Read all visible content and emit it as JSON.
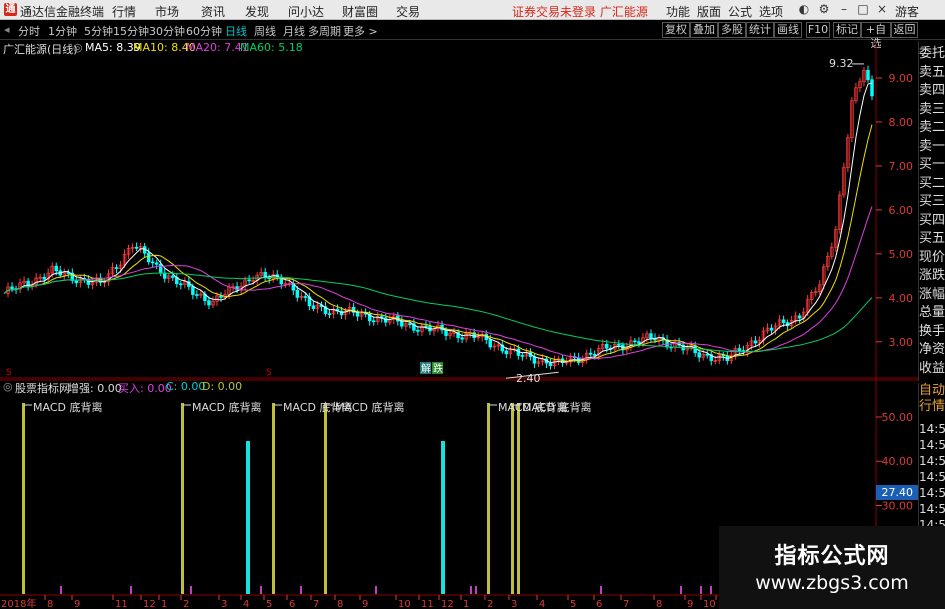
{
  "app": {
    "logo_text": "通",
    "name": "通达信金融终端",
    "warning": "证券交易未登录",
    "stock_name": "广汇能源",
    "guest": "游客"
  },
  "menu": [
    "行情",
    "市场",
    "资讯",
    "发现",
    "问小达",
    "财富圈",
    "交易"
  ],
  "right_menu": [
    "功能",
    "版面",
    "公式",
    "选项"
  ],
  "periods": [
    "分时",
    "1分钟",
    "5分钟",
    "15分钟",
    "30分钟",
    "60分钟",
    "日线",
    "周线",
    "月线",
    "多周期",
    "更多 >"
  ],
  "active_period": "日线",
  "toolbar_right": [
    "复权",
    "叠加",
    "多股",
    "统计",
    "画线",
    "F10",
    "标记",
    "+自选",
    "返回"
  ],
  "chart_title": "广汇能源(日线)",
  "ma": {
    "ma5": "MA5: 8.39",
    "ma10": "MA10: 8.40",
    "ma20": "MA20: 7.41",
    "ma60": "MA60: 5.18"
  },
  "colors": {
    "ma5": "#ffffff",
    "ma10": "#f0e000",
    "ma20": "#e040e0",
    "ma60": "#00d060",
    "up": "#ff3b3b",
    "down": "#00ffff",
    "signal": "#bfbf3a",
    "grid": "#8a0000",
    "axis": "#d83a3a"
  },
  "price_axis": [
    "9.00",
    "8.00",
    "7.00",
    "6.00",
    "5.00",
    "4.00",
    "3.00"
  ],
  "high_label": "9.32",
  "low_label": "2.40",
  "event_markers": [
    "解",
    "跌"
  ],
  "indicator": {
    "name": "股票指标网",
    "zengqiang": "增强: 0.00",
    "buy": "买入: 0.00",
    "c": "C: 0.00",
    "d": "D: 0.00"
  },
  "signal_label": "MACD 底背离",
  "ind_axis": [
    "50.00",
    "40.00",
    "30.00",
    "20.00"
  ],
  "ind_highlight": "27.40",
  "side_orders": [
    "委托",
    "卖五",
    "卖四",
    "卖三",
    "卖二",
    "卖一",
    "买一",
    "买二",
    "买三",
    "买四",
    "买五",
    "现价",
    "涨跌",
    "涨幅",
    "总量",
    "换手",
    "净资",
    "收益"
  ],
  "side_bottom_title": "自动行情",
  "side_bottom_values": [
    "14:5",
    "14:5",
    "14:5",
    "14:5",
    "14:5",
    "14:5",
    "14:5",
    "14:5",
    "14:5",
    "14:5",
    "14:5",
    "14:5"
  ],
  "time_axis": [
    "2018年",
    "8",
    "9",
    "11",
    "12",
    "1",
    "2",
    "3",
    "4",
    "5",
    "6",
    "7",
    "8",
    "9",
    "10",
    "11",
    "12",
    "1",
    "2",
    "3",
    "4",
    "5",
    "6",
    "7",
    "8",
    "9",
    "10",
    "11",
    "12",
    "1",
    "2"
  ],
  "watermark": {
    "line1": "指标公式网",
    "line2": "www.zbgs3.com"
  }
}
